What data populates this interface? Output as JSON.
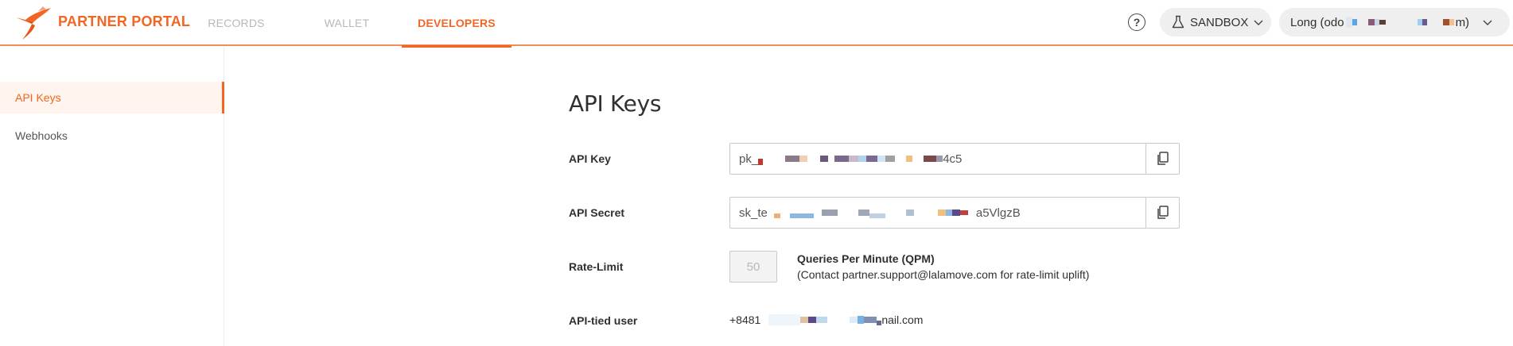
{
  "header": {
    "brand": "PARTNER PORTAL",
    "tabs": [
      {
        "label": "RECORDS",
        "active": false
      },
      {
        "label": "WALLET",
        "active": false
      },
      {
        "label": "DEVELOPERS",
        "active": true
      }
    ],
    "help_label": "?",
    "environment": {
      "label": "SANDBOX",
      "icon": "flask-icon"
    },
    "account": {
      "prefix": "Long (odo",
      "suffix": "m)",
      "icon": "chevron-down-icon"
    }
  },
  "sidebar": {
    "items": [
      {
        "label": "API Keys",
        "active": true
      },
      {
        "label": "Webhooks",
        "active": false
      }
    ]
  },
  "main": {
    "title": "API Keys",
    "api_key": {
      "label": "API Key",
      "prefix": "pk_",
      "suffix": "4c5"
    },
    "api_secret": {
      "label": "API Secret",
      "prefix": "sk_te",
      "suffix": "a5VlgzB"
    },
    "rate_limit": {
      "label": "Rate-Limit",
      "value": "50",
      "unit": "Queries Per Minute (QPM)",
      "note": "(Contact partner.support@lalamove.com for rate-limit uplift)"
    },
    "api_user": {
      "label": "API-tied user",
      "prefix": "+8481",
      "suffix": "nail.com"
    }
  },
  "colors": {
    "accent": "#f16622",
    "active_bg": "#fff4ee",
    "divider": "#f28c5a"
  }
}
